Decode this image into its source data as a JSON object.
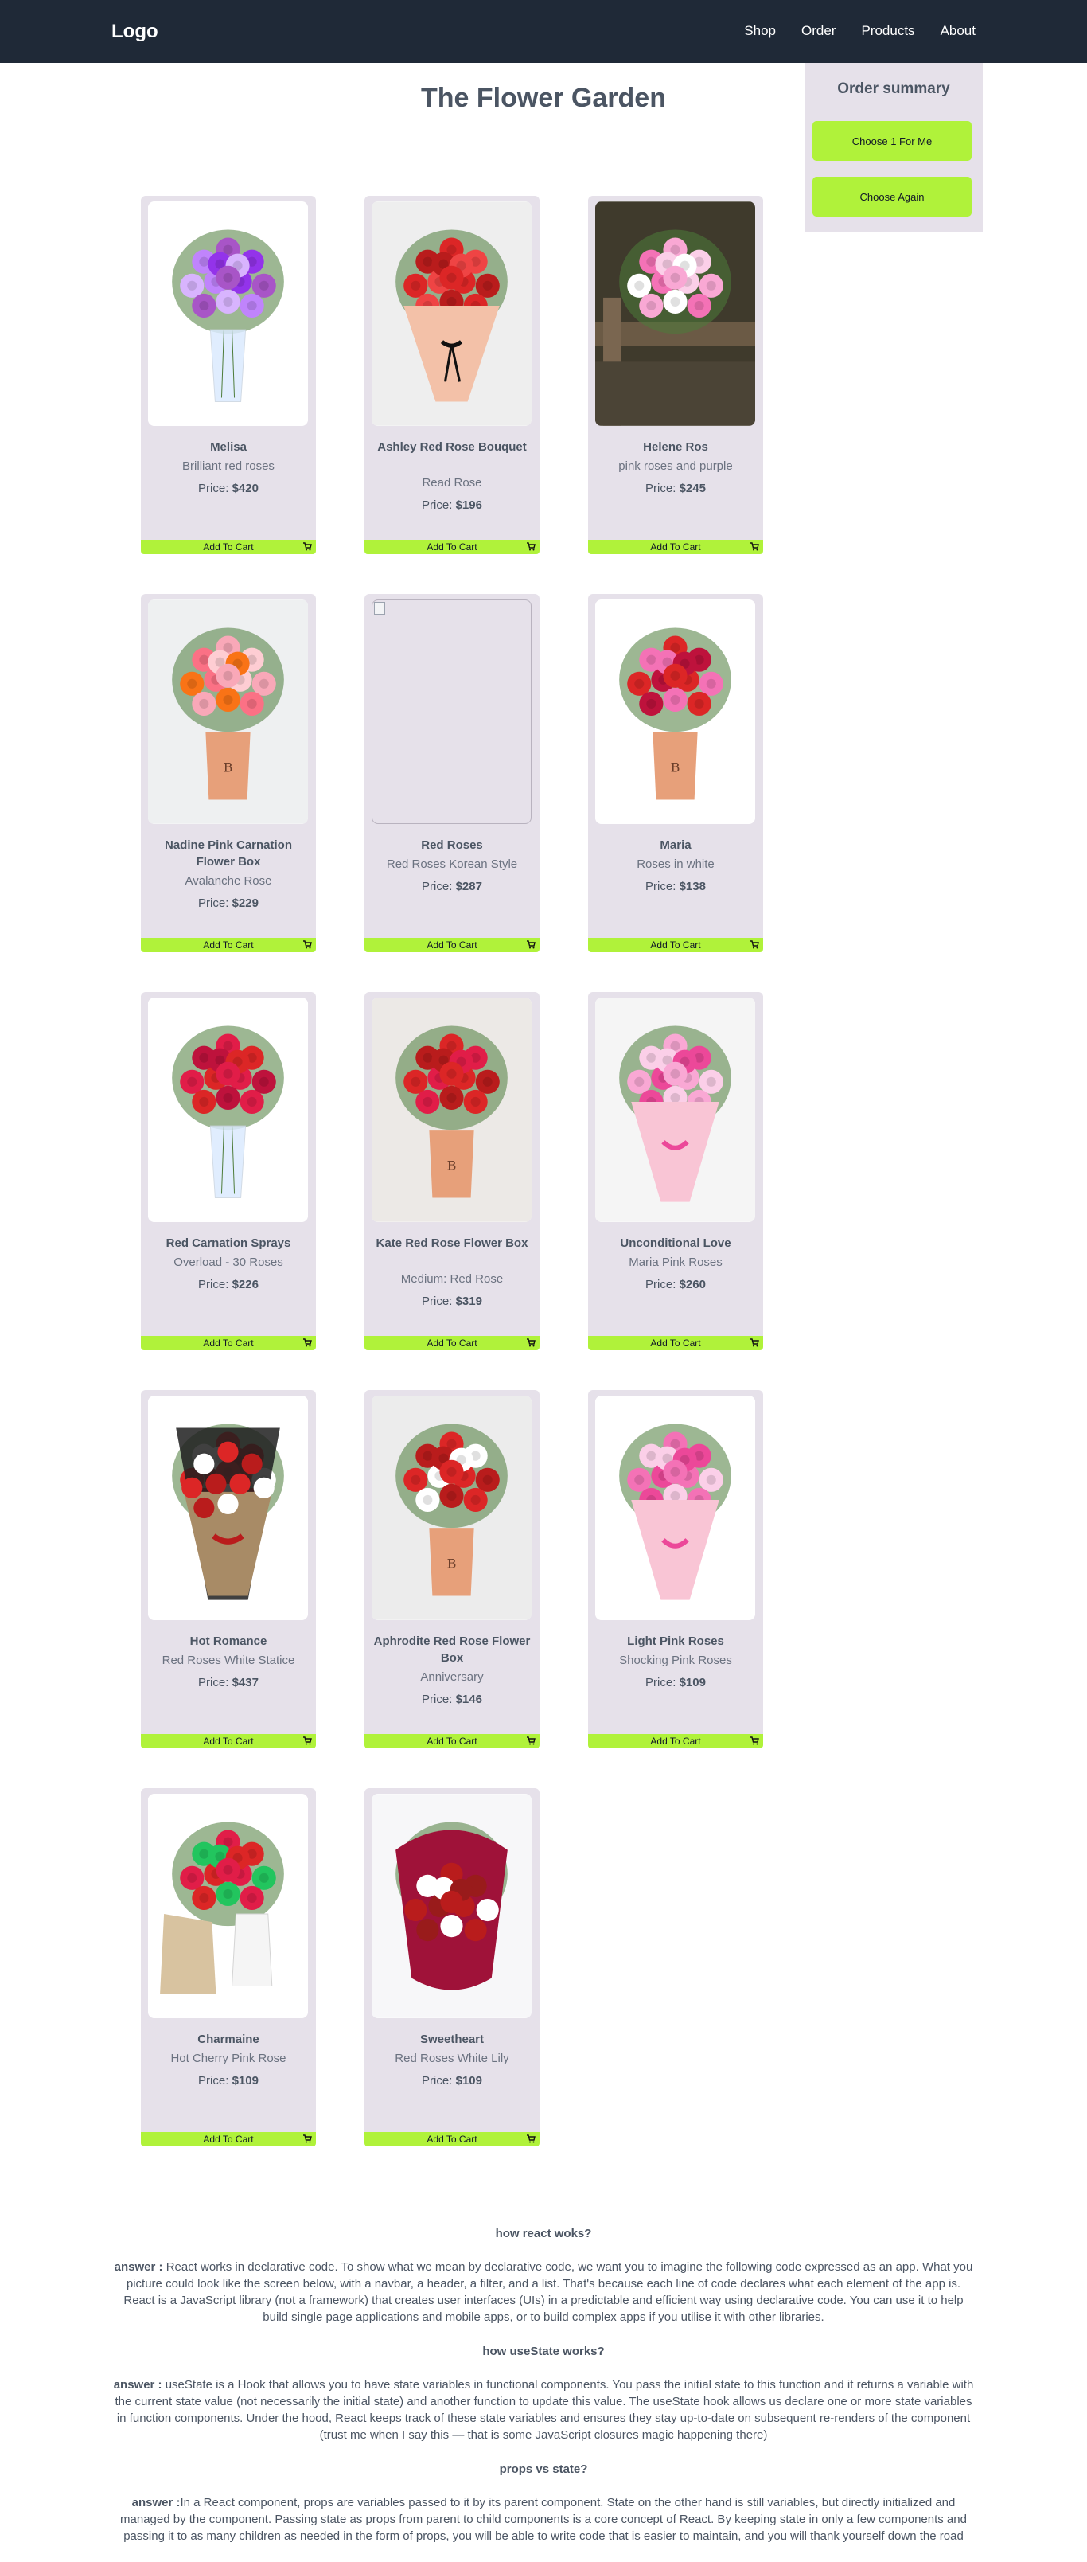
{
  "navbar": {
    "logo": "Logo",
    "links": [
      "Shop",
      "Order",
      "Products",
      "About"
    ]
  },
  "page_title": "The Flower Garden",
  "order_summary": {
    "title": "Order summary",
    "choose_one": "Choose 1 For Me",
    "choose_again": "Choose Again"
  },
  "cart_button_label": "Add To Cart",
  "price_label": "Price:",
  "colors": {
    "navbar": "#1f2937",
    "accent": "#b0f23a",
    "card": "#e6e1ea"
  },
  "products": [
    {
      "name": "Melisa",
      "sub": "Brilliant red roses",
      "price": "$420",
      "icon": "purple-rose-vase"
    },
    {
      "name": "Ashley Red Rose Bouquet",
      "sub": "Read Rose",
      "price": "$196",
      "icon": "red-bouquet"
    },
    {
      "name": "Helene Ros",
      "sub": "pink roses and purple",
      "price": "$245",
      "icon": "pink-bouquet-fence"
    },
    {
      "name": "Nadine Pink Carnation Flower Box",
      "sub": "Avalanche Rose",
      "price": "$229",
      "icon": "pink-flower-box"
    },
    {
      "name": "Red Roses",
      "sub": "Red Roses Korean Style",
      "price": "$287",
      "icon": "broken-image"
    },
    {
      "name": "Maria",
      "sub": "Roses in white",
      "price": "$138",
      "icon": "red-flower-box"
    },
    {
      "name": "Red Carnation Sprays",
      "sub": "Overload - 30 Roses",
      "price": "$226",
      "icon": "red-rose-vase"
    },
    {
      "name": "Kate Red Rose Flower Box",
      "sub": "Medium: Red Rose",
      "price": "$319",
      "icon": "red-rose-box"
    },
    {
      "name": "Unconditional Love",
      "sub": "Maria Pink Roses",
      "price": "$260",
      "icon": "pink-wrapped-bouquet"
    },
    {
      "name": "Hot Romance",
      "sub": "Red Roses White Statice",
      "price": "$437",
      "icon": "dark-wrapped-bouquet"
    },
    {
      "name": "Aphrodite Red Rose Flower Box",
      "sub": "Anniversary",
      "price": "$146",
      "icon": "red-rose-box-wrap"
    },
    {
      "name": "Light Pink Roses",
      "sub": "Shocking Pink Roses",
      "price": "$109",
      "icon": "pink-bouquet-hand"
    },
    {
      "name": "Charmaine",
      "sub": "Hot Cherry Pink Rose",
      "price": "$109",
      "icon": "red-rose-pitcher"
    },
    {
      "name": "Sweetheart",
      "sub": "Red Roses White Lily",
      "price": "$109",
      "icon": "red-lily-bouquet"
    }
  ],
  "qa": [
    {
      "question": "how react woks?",
      "answer_label": "answer :",
      "answer": "React works in declarative code. To show what we mean by declarative code, we want you to imagine the following code expressed as an app. What you picture could look like the screen below, with a navbar, a header, a filter, and a list. That's because each line of code declares what each element of the app is. React is a JavaScript library (not a framework) that creates user interfaces (UIs) in a predictable and efficient way using declarative code. You can use it to help build single page applications and mobile apps, or to build complex apps if you utilise it with other libraries."
    },
    {
      "question": "how useState works?",
      "answer_label": "answer :",
      "answer": "useState is a Hook that allows you to have state variables in functional components. You pass the initial state to this function and it returns a variable with the current state value (not necessarily the initial state) and another function to update this value. The useState hook allows us declare one or more state variables in function components. Under the hood, React keeps track of these state variables and ensures they stay up-to-date on subsequent re-renders of the component (trust me when I say this — that is some JavaScript closures magic happening there)"
    },
    {
      "question": "props vs state?",
      "answer_label": "answer :",
      "answer": "In a React component, props are variables passed to it by its parent component. State on the other hand is still variables, but directly initialized and managed by the component. Passing state as props from parent to child components is a core concept of React. By keeping state in only a few components and passing it to as many children as needed in the form of props, you will be able to write code that is easier to maintain, and you will thank yourself down the road"
    }
  ]
}
